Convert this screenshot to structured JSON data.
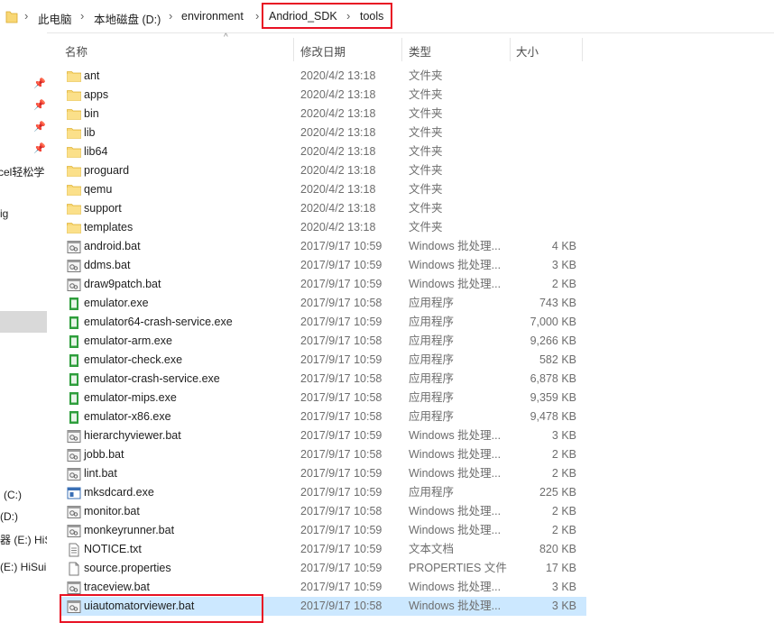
{
  "address_bar": {
    "crumbs": [
      "此电脑",
      "本地磁盘 (D:)",
      "environment",
      "Andriod_SDK",
      "tools"
    ]
  },
  "nav_pane": {
    "fragments": [
      "cel轻松学",
      "ig",
      "(C:)",
      "(D:)",
      "器 (E:) HiS",
      "(E:) HiSui"
    ]
  },
  "columns": {
    "name": "名称",
    "date": "修改日期",
    "type": "类型",
    "size": "大小"
  },
  "colors": {
    "selection": "#cce8ff",
    "annotation": "#e81123",
    "folder": "#f8d775"
  },
  "files": [
    {
      "name": "ant",
      "date": "2020/4/2 13:18",
      "type": "文件夹",
      "size": "",
      "icon": "folder-icon"
    },
    {
      "name": "apps",
      "date": "2020/4/2 13:18",
      "type": "文件夹",
      "size": "",
      "icon": "folder-icon"
    },
    {
      "name": "bin",
      "date": "2020/4/2 13:18",
      "type": "文件夹",
      "size": "",
      "icon": "folder-icon"
    },
    {
      "name": "lib",
      "date": "2020/4/2 13:18",
      "type": "文件夹",
      "size": "",
      "icon": "folder-icon"
    },
    {
      "name": "lib64",
      "date": "2020/4/2 13:18",
      "type": "文件夹",
      "size": "",
      "icon": "folder-icon"
    },
    {
      "name": "proguard",
      "date": "2020/4/2 13:18",
      "type": "文件夹",
      "size": "",
      "icon": "folder-icon"
    },
    {
      "name": "qemu",
      "date": "2020/4/2 13:18",
      "type": "文件夹",
      "size": "",
      "icon": "folder-icon"
    },
    {
      "name": "support",
      "date": "2020/4/2 13:18",
      "type": "文件夹",
      "size": "",
      "icon": "folder-icon"
    },
    {
      "name": "templates",
      "date": "2020/4/2 13:18",
      "type": "文件夹",
      "size": "",
      "icon": "folder-icon"
    },
    {
      "name": "android.bat",
      "date": "2017/9/17 10:59",
      "type": "Windows 批处理...",
      "size": "4 KB",
      "icon": "batch-file-icon"
    },
    {
      "name": "ddms.bat",
      "date": "2017/9/17 10:59",
      "type": "Windows 批处理...",
      "size": "3 KB",
      "icon": "batch-file-icon"
    },
    {
      "name": "draw9patch.bat",
      "date": "2017/9/17 10:59",
      "type": "Windows 批处理...",
      "size": "2 KB",
      "icon": "batch-file-icon"
    },
    {
      "name": "emulator.exe",
      "date": "2017/9/17 10:58",
      "type": "应用程序",
      "size": "743 KB",
      "icon": "android-exe-icon"
    },
    {
      "name": "emulator64-crash-service.exe",
      "date": "2017/9/17 10:59",
      "type": "应用程序",
      "size": "7,000 KB",
      "icon": "android-exe-icon"
    },
    {
      "name": "emulator-arm.exe",
      "date": "2017/9/17 10:58",
      "type": "应用程序",
      "size": "9,266 KB",
      "icon": "android-exe-icon"
    },
    {
      "name": "emulator-check.exe",
      "date": "2017/9/17 10:59",
      "type": "应用程序",
      "size": "582 KB",
      "icon": "android-exe-icon"
    },
    {
      "name": "emulator-crash-service.exe",
      "date": "2017/9/17 10:58",
      "type": "应用程序",
      "size": "6,878 KB",
      "icon": "android-exe-icon"
    },
    {
      "name": "emulator-mips.exe",
      "date": "2017/9/17 10:58",
      "type": "应用程序",
      "size": "9,359 KB",
      "icon": "android-exe-icon"
    },
    {
      "name": "emulator-x86.exe",
      "date": "2017/9/17 10:58",
      "type": "应用程序",
      "size": "9,478 KB",
      "icon": "android-exe-icon"
    },
    {
      "name": "hierarchyviewer.bat",
      "date": "2017/9/17 10:59",
      "type": "Windows 批处理...",
      "size": "3 KB",
      "icon": "batch-file-icon"
    },
    {
      "name": "jobb.bat",
      "date": "2017/9/17 10:58",
      "type": "Windows 批处理...",
      "size": "2 KB",
      "icon": "batch-file-icon"
    },
    {
      "name": "lint.bat",
      "date": "2017/9/17 10:59",
      "type": "Windows 批处理...",
      "size": "2 KB",
      "icon": "batch-file-icon"
    },
    {
      "name": "mksdcard.exe",
      "date": "2017/9/17 10:59",
      "type": "应用程序",
      "size": "225 KB",
      "icon": "app-exe-icon"
    },
    {
      "name": "monitor.bat",
      "date": "2017/9/17 10:58",
      "type": "Windows 批处理...",
      "size": "2 KB",
      "icon": "batch-file-icon"
    },
    {
      "name": "monkeyrunner.bat",
      "date": "2017/9/17 10:59",
      "type": "Windows 批处理...",
      "size": "2 KB",
      "icon": "batch-file-icon"
    },
    {
      "name": "NOTICE.txt",
      "date": "2017/9/17 10:59",
      "type": "文本文档",
      "size": "820 KB",
      "icon": "text-file-icon"
    },
    {
      "name": "source.properties",
      "date": "2017/9/17 10:59",
      "type": "PROPERTIES 文件",
      "size": "17 KB",
      "icon": "blank-file-icon"
    },
    {
      "name": "traceview.bat",
      "date": "2017/9/17 10:59",
      "type": "Windows 批处理...",
      "size": "3 KB",
      "icon": "batch-file-icon"
    },
    {
      "name": "uiautomatorviewer.bat",
      "date": "2017/9/17 10:58",
      "type": "Windows 批处理...",
      "size": "3 KB",
      "icon": "batch-file-icon",
      "selected": true
    }
  ]
}
